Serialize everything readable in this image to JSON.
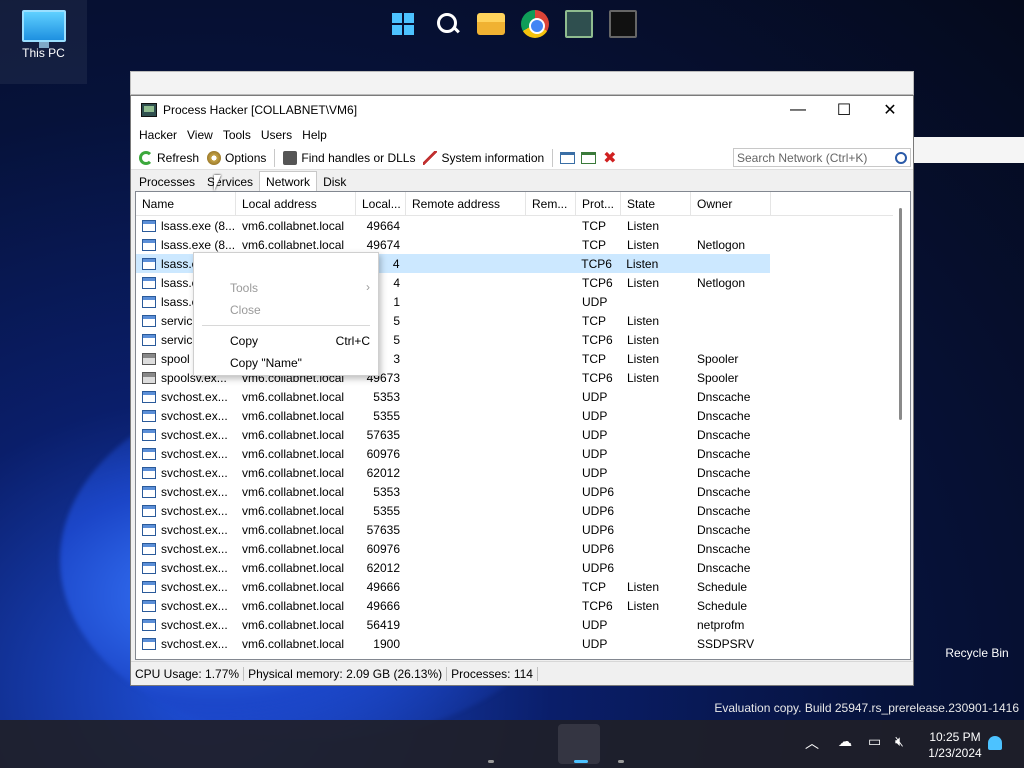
{
  "desktop": {
    "this_pc_label": "This PC",
    "recycle_bin_label": "Recycle Bin",
    "eval_text": "Evaluation copy. Build 25947.rs_prerelease.230901-1416"
  },
  "window": {
    "title": "Process Hacker [COLLABNET\\VM6]",
    "minimize": "—",
    "maximize": "☐",
    "close": "✕"
  },
  "menu": [
    "Hacker",
    "View",
    "Tools",
    "Users",
    "Help"
  ],
  "toolbar": {
    "refresh": "Refresh",
    "options": "Options",
    "find_handles": "Find handles or DLLs",
    "system_information": "System information",
    "search_placeholder": "Search Network (Ctrl+K)"
  },
  "tabs": [
    "Processes",
    "Services",
    "Network",
    "Disk"
  ],
  "active_tab": "Network",
  "columns": [
    "Name",
    "Local address",
    "Local...",
    "Remote address",
    "Rem...",
    "Prot...",
    "State",
    "Owner"
  ],
  "rows": [
    {
      "name": "lsass.exe (8...",
      "local": "vm6.collabnet.local",
      "port": "49664",
      "remote": "",
      "rport": "",
      "proto": "TCP",
      "state": "Listen",
      "owner": "",
      "icon": "process"
    },
    {
      "name": "lsass.exe (8...",
      "local": "vm6.collabnet.local",
      "port": "49674",
      "remote": "",
      "rport": "",
      "proto": "TCP",
      "state": "Listen",
      "owner": "Netlogon",
      "icon": "process"
    },
    {
      "name": "lsass.e",
      "local": "",
      "port": "4",
      "remote": "",
      "rport": "",
      "proto": "TCP6",
      "state": "Listen",
      "owner": "",
      "icon": "process",
      "selected": true
    },
    {
      "name": "lsass.e",
      "local": "",
      "port": "4",
      "remote": "",
      "rport": "",
      "proto": "TCP6",
      "state": "Listen",
      "owner": "Netlogon",
      "icon": "process"
    },
    {
      "name": "lsass.e",
      "local": "",
      "port": "1",
      "remote": "",
      "rport": "",
      "proto": "UDP",
      "state": "",
      "owner": "",
      "icon": "process"
    },
    {
      "name": "servic",
      "local": "",
      "port": "5",
      "remote": "",
      "rport": "",
      "proto": "TCP",
      "state": "Listen",
      "owner": "",
      "icon": "process"
    },
    {
      "name": "servic",
      "local": "",
      "port": "5",
      "remote": "",
      "rport": "",
      "proto": "TCP6",
      "state": "Listen",
      "owner": "",
      "icon": "process"
    },
    {
      "name": "spool",
      "local": "",
      "port": "3",
      "remote": "",
      "rport": "",
      "proto": "TCP",
      "state": "Listen",
      "owner": "Spooler",
      "icon": "printer"
    },
    {
      "name": "spoolsv.ex...",
      "local": "vm6.collabnet.local",
      "port": "49673",
      "remote": "",
      "rport": "",
      "proto": "TCP6",
      "state": "Listen",
      "owner": "Spooler",
      "icon": "printer"
    },
    {
      "name": "svchost.ex...",
      "local": "vm6.collabnet.local",
      "port": "5353",
      "remote": "",
      "rport": "",
      "proto": "UDP",
      "state": "",
      "owner": "Dnscache",
      "icon": "process"
    },
    {
      "name": "svchost.ex...",
      "local": "vm6.collabnet.local",
      "port": "5355",
      "remote": "",
      "rport": "",
      "proto": "UDP",
      "state": "",
      "owner": "Dnscache",
      "icon": "process"
    },
    {
      "name": "svchost.ex...",
      "local": "vm6.collabnet.local",
      "port": "57635",
      "remote": "",
      "rport": "",
      "proto": "UDP",
      "state": "",
      "owner": "Dnscache",
      "icon": "process"
    },
    {
      "name": "svchost.ex...",
      "local": "vm6.collabnet.local",
      "port": "60976",
      "remote": "",
      "rport": "",
      "proto": "UDP",
      "state": "",
      "owner": "Dnscache",
      "icon": "process"
    },
    {
      "name": "svchost.ex...",
      "local": "vm6.collabnet.local",
      "port": "62012",
      "remote": "",
      "rport": "",
      "proto": "UDP",
      "state": "",
      "owner": "Dnscache",
      "icon": "process"
    },
    {
      "name": "svchost.ex...",
      "local": "vm6.collabnet.local",
      "port": "5353",
      "remote": "",
      "rport": "",
      "proto": "UDP6",
      "state": "",
      "owner": "Dnscache",
      "icon": "process"
    },
    {
      "name": "svchost.ex...",
      "local": "vm6.collabnet.local",
      "port": "5355",
      "remote": "",
      "rport": "",
      "proto": "UDP6",
      "state": "",
      "owner": "Dnscache",
      "icon": "process"
    },
    {
      "name": "svchost.ex...",
      "local": "vm6.collabnet.local",
      "port": "57635",
      "remote": "",
      "rport": "",
      "proto": "UDP6",
      "state": "",
      "owner": "Dnscache",
      "icon": "process"
    },
    {
      "name": "svchost.ex...",
      "local": "vm6.collabnet.local",
      "port": "60976",
      "remote": "",
      "rport": "",
      "proto": "UDP6",
      "state": "",
      "owner": "Dnscache",
      "icon": "process"
    },
    {
      "name": "svchost.ex...",
      "local": "vm6.collabnet.local",
      "port": "62012",
      "remote": "",
      "rport": "",
      "proto": "UDP6",
      "state": "",
      "owner": "Dnscache",
      "icon": "process"
    },
    {
      "name": "svchost.ex...",
      "local": "vm6.collabnet.local",
      "port": "49666",
      "remote": "",
      "rport": "",
      "proto": "TCP",
      "state": "Listen",
      "owner": "Schedule",
      "icon": "process"
    },
    {
      "name": "svchost.ex...",
      "local": "vm6.collabnet.local",
      "port": "49666",
      "remote": "",
      "rport": "",
      "proto": "TCP6",
      "state": "Listen",
      "owner": "Schedule",
      "icon": "process"
    },
    {
      "name": "svchost.ex...",
      "local": "vm6.collabnet.local",
      "port": "56419",
      "remote": "",
      "rport": "",
      "proto": "UDP",
      "state": "",
      "owner": "netprofm",
      "icon": "process"
    },
    {
      "name": "svchost.ex...",
      "local": "vm6.collabnet.local",
      "port": "1900",
      "remote": "",
      "rport": "",
      "proto": "UDP",
      "state": "",
      "owner": "SSDPSRV",
      "icon": "process"
    }
  ],
  "context_menu": {
    "tools": "Tools",
    "close": "Close",
    "copy": "Copy",
    "copy_shortcut": "Ctrl+C",
    "copy_name": "Copy \"Name\"",
    "submenu_arrow": "›"
  },
  "status": {
    "cpu": "CPU Usage: 1.77%",
    "memory": "Physical memory: 2.09 GB (26.13%)",
    "processes": "Processes: 114"
  },
  "taskbar": {
    "time": "10:25 PM",
    "date": "1/23/2024",
    "tray_chevron": "︿"
  },
  "colors": {
    "selection": "#cce8ff",
    "accent": "#4cc2ff"
  }
}
